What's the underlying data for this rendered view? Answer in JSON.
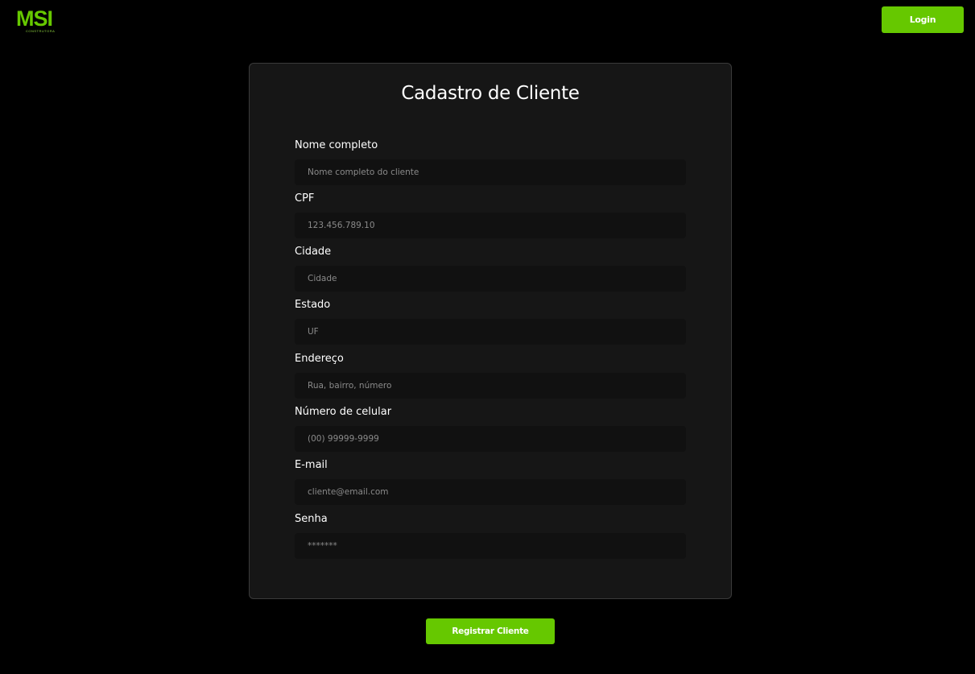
{
  "header": {
    "logo_text": "MSI",
    "logo_subtext": "CONSTRUTORA",
    "login_label": "Login"
  },
  "form": {
    "title": "Cadastro de Cliente",
    "fields": [
      {
        "label": "Nome completo",
        "placeholder": "Nome completo do cliente",
        "type": "text"
      },
      {
        "label": "CPF",
        "placeholder": "123.456.789.10",
        "type": "text"
      },
      {
        "label": "Cidade",
        "placeholder": "Cidade",
        "type": "text"
      },
      {
        "label": "Estado",
        "placeholder": "UF",
        "type": "text"
      },
      {
        "label": "Endereço",
        "placeholder": "Rua, bairro, número",
        "type": "text"
      },
      {
        "label": "Número de celular",
        "placeholder": "(00) 99999-9999",
        "type": "text"
      },
      {
        "label": "E-mail",
        "placeholder": "cliente@email.com",
        "type": "email"
      },
      {
        "label": "Senha",
        "placeholder": "*******",
        "type": "password"
      }
    ],
    "submit_label": "Registrar Cliente"
  },
  "colors": {
    "accent": "#66c800",
    "background": "#000000",
    "card": "#161616",
    "input": "#111111"
  }
}
